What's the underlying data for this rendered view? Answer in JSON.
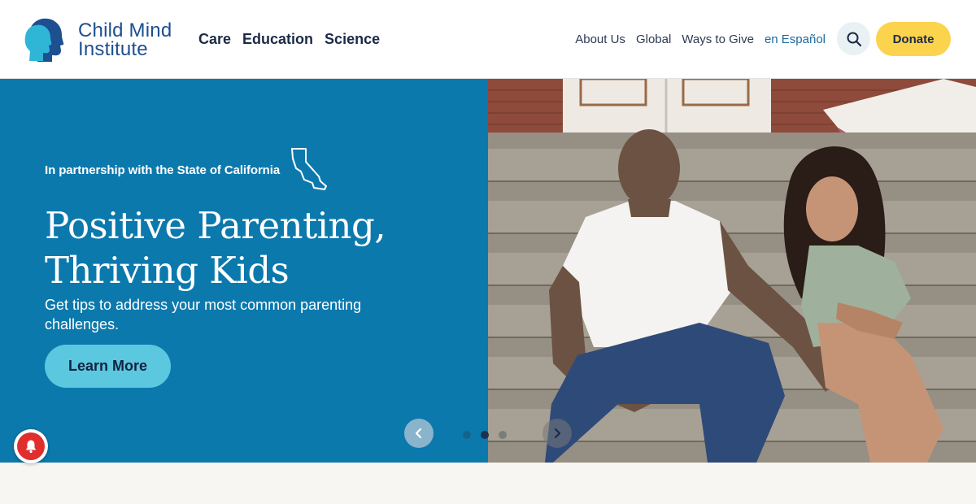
{
  "brand": {
    "name_line1": "Child Mind",
    "name_line2": "Institute",
    "logo_icon": "profile-heads-icon",
    "color": "#1d4f91"
  },
  "primary_nav": [
    "Care",
    "Education",
    "Science"
  ],
  "utility_nav": [
    "About Us",
    "Global",
    "Ways to Give",
    "en Español"
  ],
  "search": {
    "icon": "search-icon"
  },
  "donate": {
    "label": "Donate",
    "color": "#fcd34d"
  },
  "hero": {
    "partnership": "In partnership with the State of California",
    "partnership_icon": "california-outline-icon",
    "headline_line1": "Positive Parenting,",
    "headline_line2": "Thriving Kids",
    "subtext": "Get tips to address your most common parenting challenges.",
    "cta": "Learn More",
    "panel_color": "#0c79ad",
    "cta_color": "#5bc8e0",
    "photo": "father-and-daughter-sitting-on-steps"
  },
  "carousel": {
    "prev_icon": "chevron-left-icon",
    "next_icon": "chevron-right-icon",
    "slide_count": 3,
    "active_slide": 2
  },
  "notification": {
    "icon": "bell-icon",
    "color": "#e02d2d"
  }
}
